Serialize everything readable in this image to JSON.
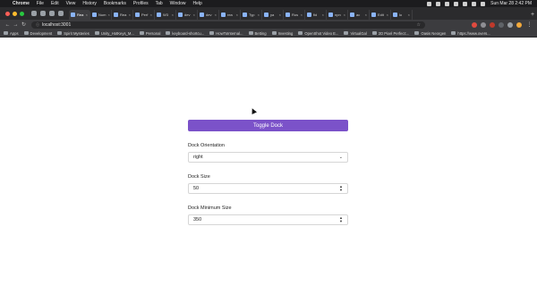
{
  "menubar": {
    "apple": "",
    "items": [
      "Chrome",
      "File",
      "Edit",
      "View",
      "History",
      "Bookmarks",
      "Profiles",
      "Tab",
      "Window",
      "Help"
    ],
    "clock": "Sun Mar 28  2:42 PM"
  },
  "tabs": [
    {
      "label": "Rea",
      "active": true
    },
    {
      "label": "Num",
      "active": false
    },
    {
      "label": "Rea",
      "active": false
    },
    {
      "label": "Perf",
      "active": false
    },
    {
      "label": "W3",
      "active": false
    },
    {
      "label": "dev",
      "active": false
    },
    {
      "label": "dev",
      "active": false
    },
    {
      "label": "rea",
      "active": false
    },
    {
      "label": "Typ",
      "active": false
    },
    {
      "label": "ya",
      "active": false
    },
    {
      "label": "Ros",
      "active": false
    },
    {
      "label": "fid",
      "active": false
    },
    {
      "label": "npn",
      "active": false
    },
    {
      "label": "ac",
      "active": false
    },
    {
      "label": "Edit",
      "active": false
    },
    {
      "label": "lo",
      "active": false
    }
  ],
  "toolbar": {
    "url": "localhost:3001"
  },
  "bookmarks": [
    {
      "label": "Apps",
      "type": "apps"
    },
    {
      "label": "Development",
      "type": "folder"
    },
    {
      "label": "Spirit Mysteries",
      "type": "site"
    },
    {
      "label": "Unity_HotKeys_M...",
      "type": "site"
    },
    {
      "label": "Personal",
      "type": "folder"
    },
    {
      "label": "keyboard-shortcu...",
      "type": "site"
    },
    {
      "label": "HowToInternal...",
      "type": "site"
    },
    {
      "label": "Betting",
      "type": "folder"
    },
    {
      "label": "Investing",
      "type": "folder"
    },
    {
      "label": "OpenShot Video E...",
      "type": "site"
    },
    {
      "label": "VirtualGal",
      "type": "site"
    },
    {
      "label": "2D Pixel Perfect:...",
      "type": "site"
    },
    {
      "label": "Oasis Neorgen",
      "type": "site"
    },
    {
      "label": "https://www.overs...",
      "type": "site"
    }
  ],
  "form": {
    "toggle_label": "Toggle Dock",
    "orientation_label": "Dock Orientation",
    "orientation_value": "right",
    "size_label": "Dock Size",
    "size_value": "50",
    "min_size_label": "Dock Minimum Size",
    "min_size_value": "350"
  },
  "colors": {
    "accent": "#7b52c9",
    "chrome_dark": "#2b2b2d",
    "toolbar": "#3c3c3f"
  }
}
